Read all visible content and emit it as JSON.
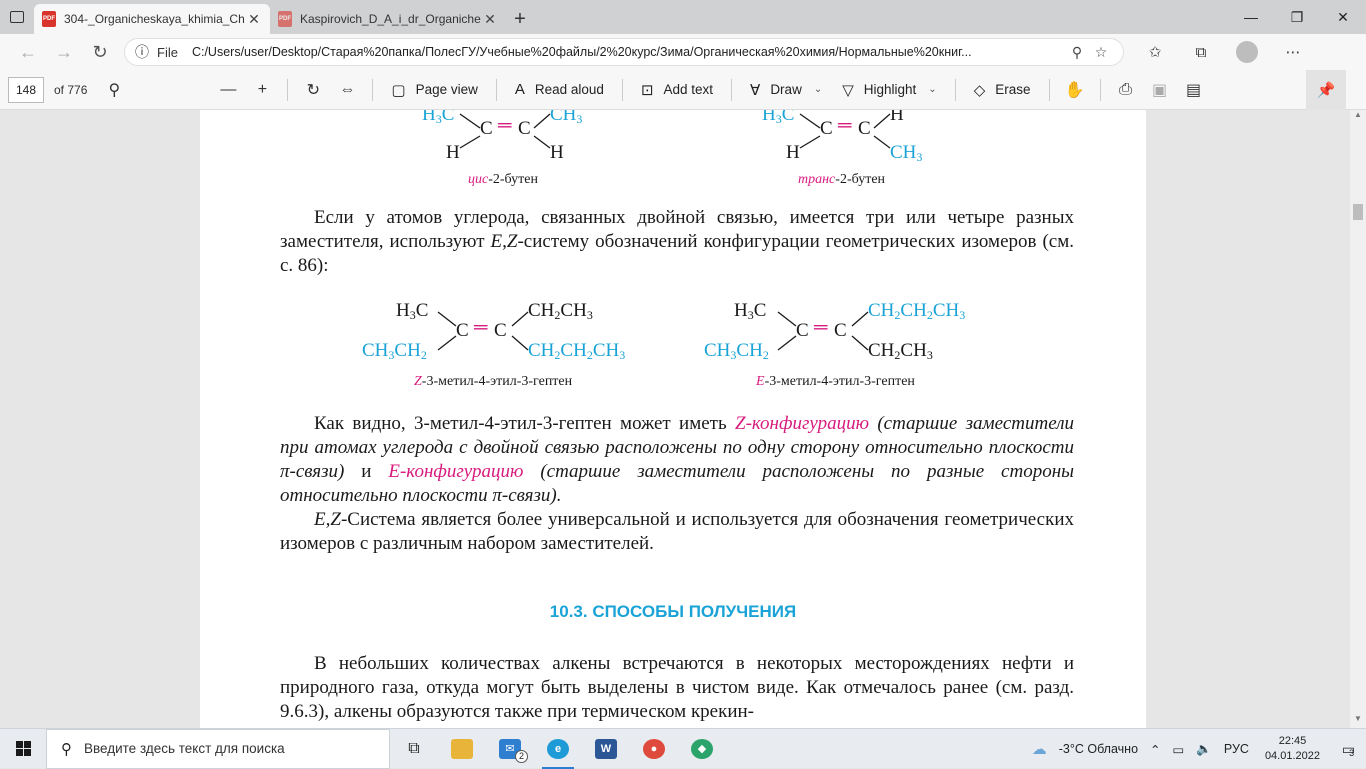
{
  "tabs": [
    {
      "title": "304-_Organicheskaya_khimia_Ch",
      "active": true,
      "pdf_label": "PDF"
    },
    {
      "title": "Kaspirovich_D_A_i_dr_Organiche",
      "active": false,
      "pdf_label": "PDF"
    }
  ],
  "address": {
    "file_label": "File",
    "url": "C:/Users/user/Desktop/Старая%20папка/ПолесГУ/Учебные%20файлы/2%20курс/Зима/Органическая%20химия/Нормальные%20книг..."
  },
  "pdf_toolbar": {
    "page_number": "148",
    "page_of": "of 776",
    "page_view": "Page view",
    "read_aloud": "Read aloud",
    "add_text": "Add text",
    "draw": "Draw",
    "highlight": "Highlight",
    "erase": "Erase"
  },
  "content": {
    "cis_caption_prefix": "цис",
    "cis_caption_rest": "-2-бутен",
    "trans_caption_prefix": "транс",
    "trans_caption_rest": "-2-бутен",
    "para1": "Если у атомов углерода, связанных двойной связью, имеется три или четыре разных заместителя, используют",
    "para1_ez": "E,Z",
    "para1_end": "-систему обозначений конфигурации геометрических изомеров (см. с. 86):",
    "z_caption_letter": "Z",
    "z_caption_rest": "-3-метил-4-этил-3-гептен",
    "e_caption_letter": "E",
    "e_caption_rest": "-3-метил-4-этил-3-гептен",
    "para2_start": "Как видно, 3-метил-4-этил-3-гептен может иметь",
    "para2_z": "Z-конфигурацию",
    "para2_z_expl": "(старшие заместители при атомах углерода с двойной связью расположены по одну сторону относительно плоскости π-связи)",
    "para2_and": "и",
    "para2_e": "E-конфигурацию",
    "para2_e_expl": "(старшие заместители расположены по разные стороны относительно плоскости π-связи).",
    "para3_ez": "E,Z",
    "para3_rest": "-Система является более универсальной и используется для обозначения геометрических изомеров с различным набором заместителей.",
    "heading": "10.3. СПОСОБЫ ПОЛУЧЕНИЯ",
    "para4": "В небольших количествах алкены встречаются в некоторых месторождениях нефти и природного газа, откуда могут быть выделены в чистом виде. Как отмечалось ранее (см. разд. 9.6.3), алкены образуются также при термическом крекин-"
  },
  "taskbar": {
    "search_placeholder": "Введите здесь текст для поиска",
    "mail_badge": "2",
    "weather": "-3°C  Облачно",
    "lang": "РУС",
    "time": "22:45",
    "date": "04.01.2022",
    "notif_count": "3"
  },
  "colors": {
    "accent_cyan": "#1aa3d6",
    "accent_magenta": "#d81b7e"
  }
}
